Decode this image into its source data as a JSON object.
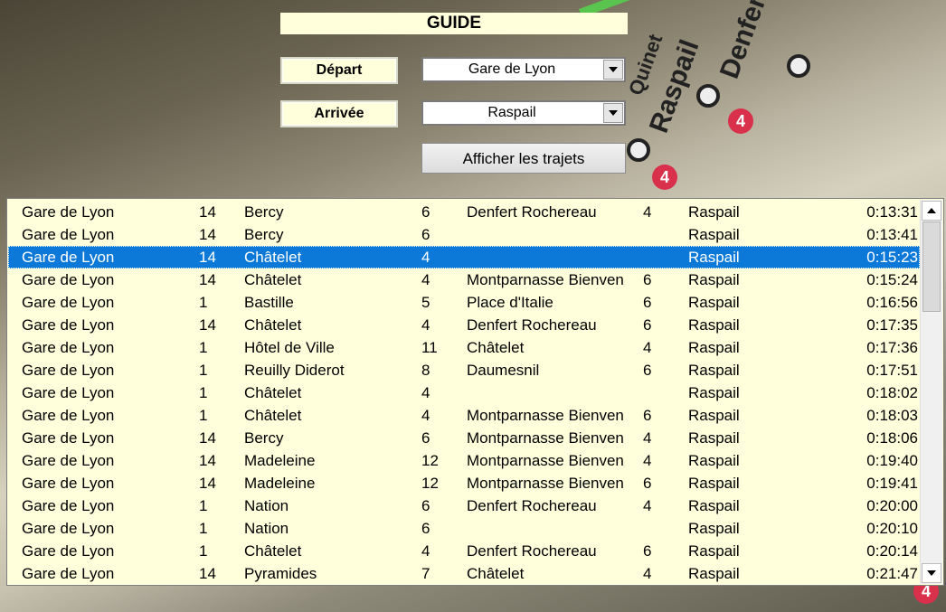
{
  "guide": {
    "title": "GUIDE"
  },
  "depart": {
    "label": "Départ",
    "selected": "Gare de Lyon"
  },
  "arrivee": {
    "label": "Arrivée",
    "selected": "Raspail"
  },
  "action": {
    "label": "Afficher les trajets"
  },
  "background_map": {
    "labels": [
      "Raspail",
      "Denfert",
      "Quinet"
    ],
    "line_badges": [
      "4",
      "4",
      "4"
    ],
    "colors": {
      "line": "#59c44e",
      "badge": "#d9304b"
    }
  },
  "colors": {
    "panel_bg": "#ffffdc",
    "selection": "#0c79d8"
  },
  "trajets": {
    "selected_index": 2,
    "rows": [
      [
        "Gare de Lyon",
        "14",
        "Bercy",
        "6",
        "Denfert Rochereau",
        "4",
        "Raspail",
        "0:13:31"
      ],
      [
        "Gare de Lyon",
        "14",
        "Bercy",
        "6",
        "",
        "",
        "Raspail",
        "0:13:41"
      ],
      [
        "Gare de Lyon",
        "14",
        "Châtelet",
        "4",
        "",
        "",
        "Raspail",
        "0:15:23"
      ],
      [
        "Gare de Lyon",
        "14",
        "Châtelet",
        "4",
        "Montparnasse Bienven",
        "6",
        "Raspail",
        "0:15:24"
      ],
      [
        "Gare de Lyon",
        "1",
        "Bastille",
        "5",
        "Place d'Italie",
        "6",
        "Raspail",
        "0:16:56"
      ],
      [
        "Gare de Lyon",
        "14",
        "Châtelet",
        "4",
        "Denfert Rochereau",
        "6",
        "Raspail",
        "0:17:35"
      ],
      [
        "Gare de Lyon",
        "1",
        "Hôtel de Ville",
        "11",
        "Châtelet",
        "4",
        "Raspail",
        "0:17:36"
      ],
      [
        "Gare de Lyon",
        "1",
        "Reuilly Diderot",
        "8",
        "Daumesnil",
        "6",
        "Raspail",
        "0:17:51"
      ],
      [
        "Gare de Lyon",
        "1",
        "Châtelet",
        "4",
        "",
        "",
        "Raspail",
        "0:18:02"
      ],
      [
        "Gare de Lyon",
        "1",
        "Châtelet",
        "4",
        "Montparnasse Bienven",
        "6",
        "Raspail",
        "0:18:03"
      ],
      [
        "Gare de Lyon",
        "14",
        "Bercy",
        "6",
        "Montparnasse Bienven",
        "4",
        "Raspail",
        "0:18:06"
      ],
      [
        "Gare de Lyon",
        "14",
        "Madeleine",
        "12",
        "Montparnasse Bienven",
        "4",
        "Raspail",
        "0:19:40"
      ],
      [
        "Gare de Lyon",
        "14",
        "Madeleine",
        "12",
        "Montparnasse Bienven",
        "6",
        "Raspail",
        "0:19:41"
      ],
      [
        "Gare de Lyon",
        "1",
        "Nation",
        "6",
        "Denfert Rochereau",
        "4",
        "Raspail",
        "0:20:00"
      ],
      [
        "Gare de Lyon",
        "1",
        "Nation",
        "6",
        "",
        "",
        "Raspail",
        "0:20:10"
      ],
      [
        "Gare de Lyon",
        "1",
        "Châtelet",
        "4",
        "Denfert Rochereau",
        "6",
        "Raspail",
        "0:20:14"
      ],
      [
        "Gare de Lyon",
        "14",
        "Pyramides",
        "7",
        "Châtelet",
        "4",
        "Raspail",
        "0:21:47"
      ]
    ]
  }
}
